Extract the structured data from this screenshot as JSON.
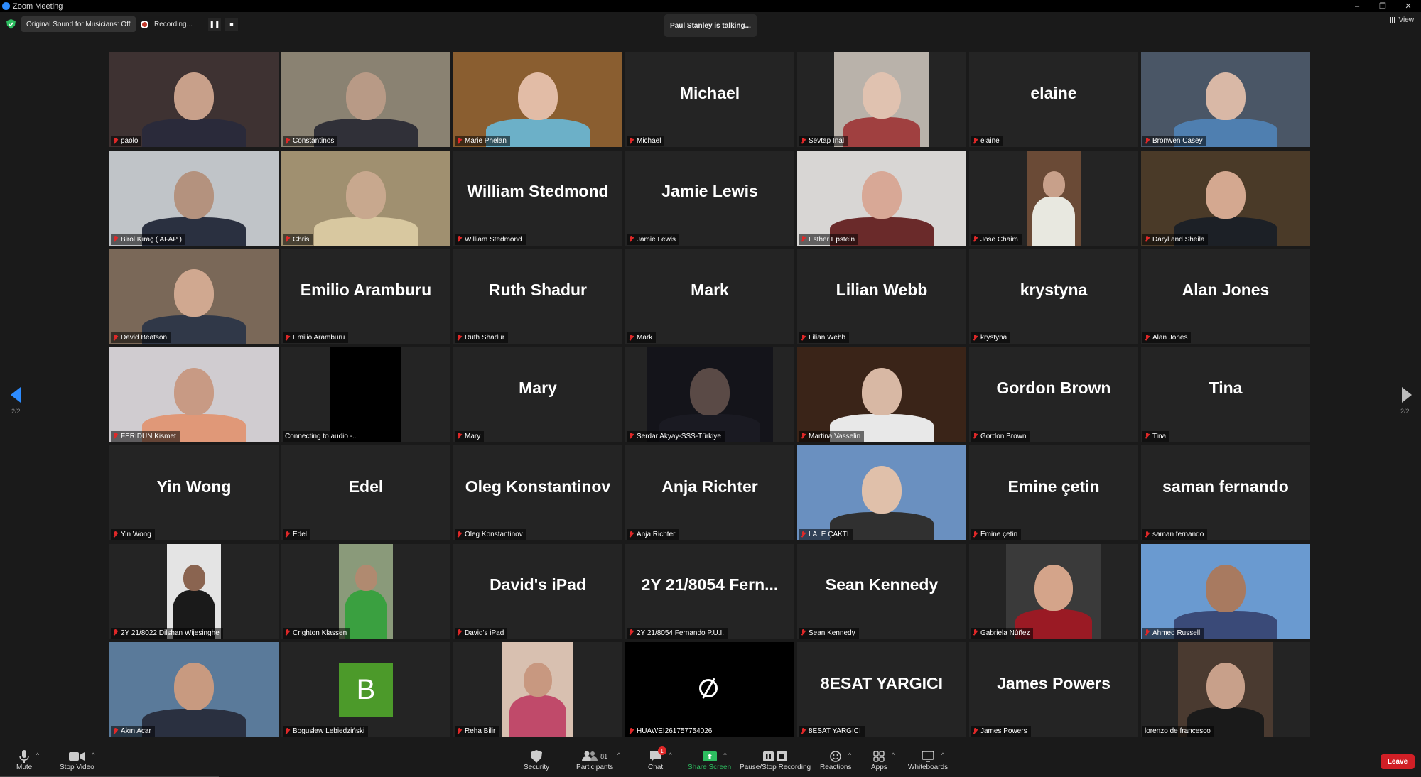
{
  "window": {
    "title": "Zoom Meeting",
    "controls": [
      "–",
      "❐",
      "✕"
    ]
  },
  "top": {
    "original_sound": "Original Sound for Musicians: Off",
    "recording": "Recording...",
    "pause_glyph": "❚❚",
    "stop_glyph": "■",
    "talking": "Paul Stanley is talking...",
    "view": "View"
  },
  "pager": {
    "left": "2/2",
    "right": "2/2"
  },
  "tiles": [
    {
      "label": "paolo",
      "big": "",
      "type": "photo",
      "bg": "#3e3232",
      "skin": "#c8a08a",
      "shirt": "#2a2a3a",
      "pw": 238
    },
    {
      "label": "Constantinos",
      "big": "",
      "type": "photo",
      "bg": "#8a8272",
      "skin": "#b89a86",
      "shirt": "#303038",
      "pw": 238
    },
    {
      "label": "Marie Phelan",
      "big": "",
      "type": "photo",
      "bg": "#8a5e30",
      "skin": "#e2bca6",
      "shirt": "#6cb0c8",
      "pw": 238
    },
    {
      "label": "Michael",
      "big": "Michael",
      "type": "name"
    },
    {
      "label": "Sevtap Inal",
      "big": "",
      "type": "photo",
      "bg": "#b9b2aa",
      "skin": "#e0c2b0",
      "shirt": "#a04040",
      "pw": 134
    },
    {
      "label": "elaine",
      "big": "elaine",
      "type": "name"
    },
    {
      "label": "Bronwen Casey",
      "big": "",
      "type": "photo",
      "bg": "#4a5666",
      "skin": "#d9b8a6",
      "shirt": "#4f7fb0",
      "pw": 238
    },
    {
      "label": "Birol Kıraç ( AFAP )",
      "big": "",
      "type": "photo",
      "bg": "#c0c4c8",
      "skin": "#b4927e",
      "shirt": "#2a3040",
      "pw": 238
    },
    {
      "label": "Chris",
      "big": "",
      "type": "photo",
      "bg": "#a09070",
      "skin": "#c8a88e",
      "shirt": "#d8c8a0",
      "pw": 238
    },
    {
      "label": "William Stedmond",
      "big": "William Stedmond",
      "type": "name"
    },
    {
      "label": "Jamie Lewis",
      "big": "Jamie Lewis",
      "type": "name"
    },
    {
      "label": "Esther Epstein",
      "big": "",
      "type": "photo",
      "bg": "#d8d6d4",
      "skin": "#d8a896",
      "shirt": "#6a2a2a",
      "pw": 238
    },
    {
      "label": "Jose Chaim",
      "big": "",
      "type": "photo",
      "bg": "#6a4a36",
      "skin": "#c8a08a",
      "shirt": "#e8e8e0",
      "pw": 76
    },
    {
      "label": "Daryl and Sheila",
      "big": "",
      "type": "photo",
      "bg": "#4a3a28",
      "skin": "#d4a890",
      "shirt": "#1c2026",
      "pw": 238
    },
    {
      "label": "David Beatson",
      "big": "",
      "type": "photo",
      "bg": "#7a6858",
      "skin": "#d0a890",
      "shirt": "#303848",
      "pw": 238
    },
    {
      "label": "Emilio Aramburu",
      "big": "Emilio Aramburu",
      "type": "name"
    },
    {
      "label": "Ruth Shadur",
      "big": "Ruth Shadur",
      "type": "name"
    },
    {
      "label": "Mark",
      "big": "Mark",
      "type": "name"
    },
    {
      "label": "Lilian Webb",
      "big": "Lilian Webb",
      "type": "name"
    },
    {
      "label": "krystyna",
      "big": "krystyna",
      "type": "name"
    },
    {
      "label": "Alan Jones",
      "big": "Alan Jones",
      "type": "name"
    },
    {
      "label": "FERIDUN Kismet",
      "big": "",
      "type": "photo",
      "bg": "#d0ccd0",
      "skin": "#c89a84",
      "shirt": "#e09878",
      "pw": 238
    },
    {
      "label": "Connecting to audio -..",
      "big": "",
      "type": "black",
      "nomic": true
    },
    {
      "label": "Mary",
      "big": "Mary",
      "type": "name"
    },
    {
      "label": "Serdar Akyay-SSS-Türkiye",
      "big": "",
      "type": "photo",
      "bg": "#14141a",
      "skin": "#5a4a46",
      "shirt": "#1a1a22",
      "pw": 178
    },
    {
      "label": "Martina Vasselin",
      "big": "",
      "type": "photo",
      "bg": "#3a2418",
      "skin": "#d8b8a4",
      "shirt": "#e8e8e8",
      "pw": 238
    },
    {
      "label": "Gordon Brown",
      "big": "Gordon Brown",
      "type": "name"
    },
    {
      "label": "Tina",
      "big": "Tina",
      "type": "name"
    },
    {
      "label": "Yin Wong",
      "big": "Yin Wong",
      "type": "name"
    },
    {
      "label": "Edel",
      "big": "Edel",
      "type": "name"
    },
    {
      "label": "Oleg Konstantinov",
      "big": "Oleg Konstantinov",
      "type": "name"
    },
    {
      "label": "Anja Richter",
      "big": "Anja Richter",
      "type": "name"
    },
    {
      "label": "LALE ÇAKTI",
      "big": "",
      "type": "photo",
      "bg": "#6a90c0",
      "skin": "#e0c0aa",
      "shirt": "#303030",
      "pw": 238
    },
    {
      "label": "Emine çetin",
      "big": "Emine çetin",
      "type": "name"
    },
    {
      "label": "saman fernando",
      "big": "saman fernando",
      "type": "name"
    },
    {
      "label": "2Y 21/8022 Dilshan Wijesinghe",
      "big": "",
      "type": "photo",
      "bg": "#e4e4e4",
      "skin": "#8a6450",
      "shirt": "#1a1a1a",
      "pw": 76
    },
    {
      "label": "Crighton Klassen",
      "big": "",
      "type": "photo",
      "bg": "#8a9a7a",
      "skin": "#b08a70",
      "shirt": "#3aa040",
      "pw": 76
    },
    {
      "label": "David's iPad",
      "big": "David's iPad",
      "type": "name"
    },
    {
      "label": "2Y 21/8054 Fernando P.U.I.",
      "big": "2Y 21/8054 Fern...",
      "type": "name"
    },
    {
      "label": "Sean Kennedy",
      "big": "Sean Kennedy",
      "type": "name"
    },
    {
      "label": "Gabriela Núñez",
      "big": "",
      "type": "photo",
      "bg": "#3a3a3a",
      "skin": "#d4a48a",
      "shirt": "#9a1a24",
      "pw": 134
    },
    {
      "label": "Ahmed Russell",
      "big": "",
      "type": "photo",
      "bg": "#6a9ad0",
      "skin": "#a87a60",
      "shirt": "#3a4a78",
      "pw": 238
    },
    {
      "label": "Akın Acar",
      "big": "",
      "type": "photo",
      "bg": "#5a7a9a",
      "skin": "#c89a80",
      "shirt": "#2a3040",
      "pw": 238
    },
    {
      "label": "Bogusław Lebiedziński",
      "big": "",
      "type": "avatarB",
      "letter": "B"
    },
    {
      "label": "Reha Bilir",
      "big": "",
      "type": "photo",
      "bg": "#d8c0b0",
      "skin": "#c89880",
      "shirt": "#c04a6a",
      "pw": 100
    },
    {
      "label": "HUAWEI261757754026",
      "big": "",
      "type": "nocam"
    },
    {
      "label": "8ESAT YARGICI",
      "big": "8ESAT YARGICI",
      "type": "name"
    },
    {
      "label": "James Powers",
      "big": "James Powers",
      "type": "name"
    },
    {
      "label": "lorenzo de francesco",
      "big": "",
      "type": "photo",
      "bg": "#4a3a30",
      "skin": "#c8a08a",
      "shirt": "#1a1a1a",
      "pw": 134,
      "nomic": true
    }
  ],
  "toolbar": {
    "mute": "Mute",
    "stop_video": "Stop Video",
    "security": "Security",
    "participants": "Participants",
    "participants_count": "81",
    "chat": "Chat",
    "chat_badge": "1",
    "share": "Share Screen",
    "pause_rec": "Pause/Stop Recording",
    "reactions": "Reactions",
    "apps": "Apps",
    "whiteboards": "Whiteboards",
    "leave": "Leave",
    "caret": "^"
  }
}
